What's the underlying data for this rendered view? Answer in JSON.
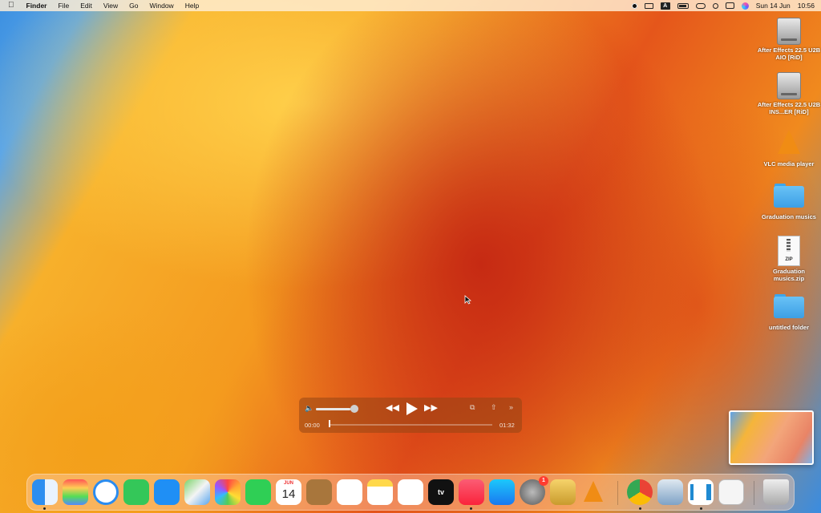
{
  "menubar": {
    "apple_icon": "apple-logo",
    "app_name": "Finder",
    "menus": [
      "File",
      "Edit",
      "View",
      "Go",
      "Window",
      "Help"
    ],
    "date": "Sun 14 Jun",
    "time": "10:56",
    "input_source": "A"
  },
  "desktop": {
    "items": [
      {
        "label": "After Effects 22.5 U2B AIO [RiD]",
        "icon": "drive-icon"
      },
      {
        "label": "After Effects 22.5 U2B INS...ER [RiD]",
        "icon": "drive-icon"
      },
      {
        "label": "VLC media player",
        "icon": "vlc-icon"
      },
      {
        "label": "Graduation musics",
        "icon": "folder-icon"
      },
      {
        "label": "Graduation musics.zip",
        "icon": "zip-icon"
      },
      {
        "label": "untitled folder",
        "icon": "folder-icon"
      }
    ],
    "zip_badge": "ZIP"
  },
  "player": {
    "time_current": "00:00",
    "time_total": "01:32",
    "volume": 0.85,
    "progress": 0.0
  },
  "dock": {
    "calendar_month": "JUN",
    "calendar_day": "14",
    "appletv_label": "tv",
    "settings_badge": "1",
    "apps": [
      "finder",
      "launchpad",
      "safari",
      "messages",
      "mail",
      "maps",
      "photos",
      "facetime",
      "calendar",
      "contacts",
      "reminders",
      "notes",
      "freeform",
      "apple-tv",
      "music",
      "app-store",
      "system-settings",
      "archive-utility",
      "vlc",
      "chrome",
      "preview",
      "vscode",
      "textedit",
      "trash"
    ]
  }
}
